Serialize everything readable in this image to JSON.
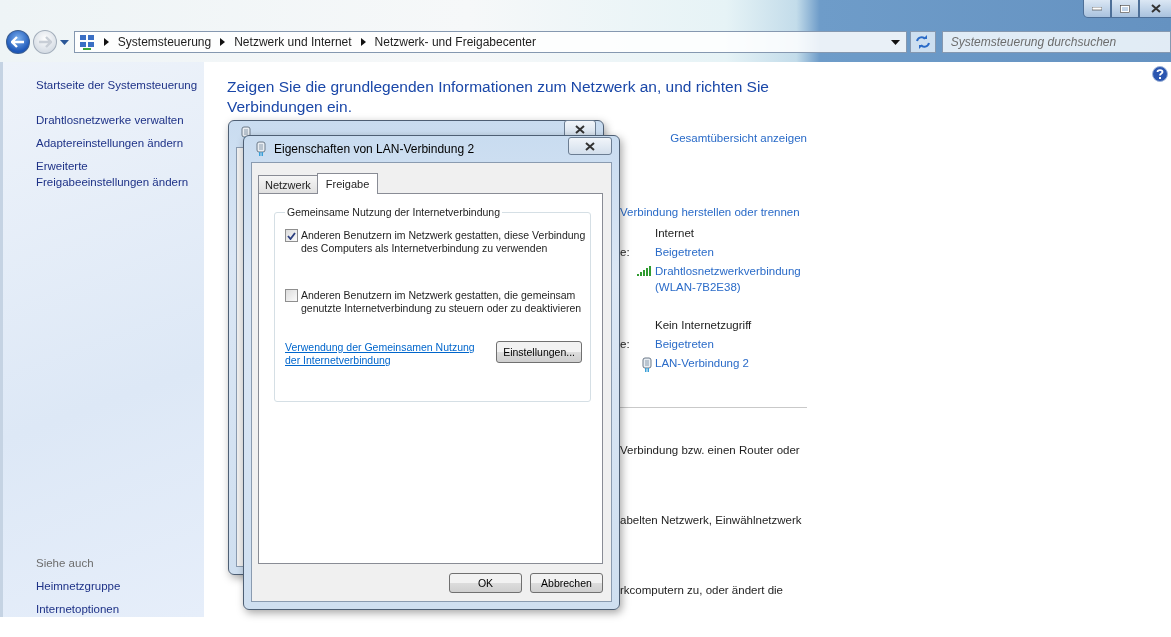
{
  "navigation": {
    "breadcrumb": [
      "Systemsteuerung",
      "Netzwerk und Internet",
      "Netzwerk- und Freigabecenter"
    ],
    "search": {
      "placeholder": "Systemsteuerung durchsuchen"
    }
  },
  "sidebar": {
    "items": [
      "Startseite der Systemsteuerung",
      "Drahtlosnetzwerke verwalten",
      "Adaptereinstellungen ändern",
      "Erweiterte Freigabeeinstellungen ändern"
    ],
    "see_also": {
      "title": "Siehe auch",
      "items": [
        "Heimnetzgruppe",
        "Internetoptionen"
      ]
    }
  },
  "content": {
    "heading": "Zeigen Sie die grundlegenden Informationen zum Netzwerk an, und richten Sie Verbindungen ein.",
    "overview_link": "Gesamtübersicht anzeigen",
    "section_link": "Verbindung herstellen oder trennen",
    "networks": [
      {
        "kind": "wireless",
        "access": "Internet",
        "label_fragment": "e:",
        "status": "Beigetreten",
        "connection": "Drahtlosnetzwerkverbindung (WLAN-7B2E38)"
      },
      {
        "kind": "wired",
        "access": "Kein Internetzugriff",
        "label_fragment": "e:",
        "status": "Beigetreten",
        "connection": "LAN-Verbindung 2"
      }
    ],
    "fragments": [
      "Verbindung bzw. einen Router oder",
      "abelten Netzwerk, Einwählnetzwerk",
      "rkcomputern zu, oder ändert die"
    ]
  },
  "dialog": {
    "title": "Eigenschaften von LAN-Verbindung 2",
    "tabs": [
      {
        "label": "Netzwerk",
        "selected": false
      },
      {
        "label": "Freigabe",
        "selected": true
      }
    ],
    "group": {
      "title": "Gemeinsame Nutzung der Internetverbindung",
      "options": [
        {
          "label": "Anderen Benutzern im Netzwerk gestatten, diese Verbindung des Computers als Internetverbindung zu verwenden",
          "checked": true
        },
        {
          "label": "Anderen Benutzern im Netzwerk gestatten, die gemeinsam genutzte Internetverbindung zu steuern oder zu deaktivieren",
          "checked": false
        }
      ],
      "link": "Verwendung der Gemeinsamen Nutzung der Internetverbindung",
      "button": "Einstellungen..."
    },
    "buttons": [
      "OK",
      "Abbrechen"
    ]
  }
}
